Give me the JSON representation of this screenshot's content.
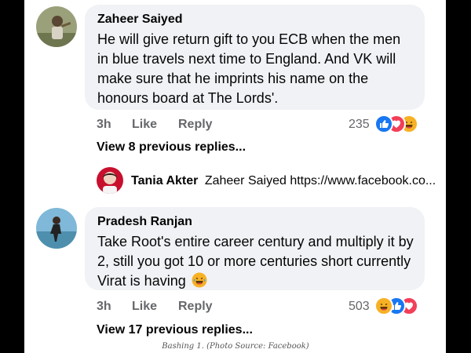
{
  "comments": [
    {
      "author": "Zaheer Saiyed",
      "text": "He will give return gift to you ECB when the men in blue travels next time to England. And VK will make sure that he imprints his name on the honours board at The Lords'.",
      "time": "3h",
      "like_label": "Like",
      "reply_label": "Reply",
      "reaction_count": "235",
      "reactions": [
        "like",
        "love",
        "haha"
      ],
      "view_replies": "View 8 previous replies...",
      "reply": {
        "author": "Tania Akter",
        "text": "Zaheer Saiyed https://www.facebook.co..."
      }
    },
    {
      "author": "Pradesh Ranjan",
      "text": "Take Root's entire career century and multiply it by 2, still you got 10 or more centuries short currently Virat is having",
      "emoji": "laughing-emoji",
      "time": "3h",
      "like_label": "Like",
      "reply_label": "Reply",
      "reaction_count": "503",
      "reactions": [
        "haha",
        "like",
        "love"
      ],
      "view_replies": "View 17 previous replies..."
    }
  ],
  "caption": "Bashing 1. (Photo Source: Facebook)",
  "colors": {
    "like": "#1877f2",
    "love": "#f33e58",
    "haha": "#f7b125",
    "bubble": "#f0f2f5",
    "meta": "#65676b"
  }
}
